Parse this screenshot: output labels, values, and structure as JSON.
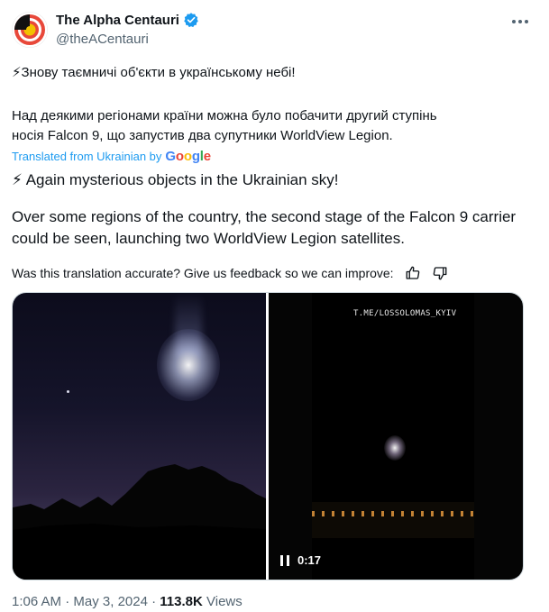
{
  "author": {
    "display_name": "The Alpha Centauri",
    "handle": "@theACentauri"
  },
  "tweet": {
    "original_line_1": "⚡Знову таємничі об'єкти в українському небі!",
    "original_line_2": "Над деякими регіонами країни можна було побачити другий ступінь носія Falcon 9, що запустив два супутники WorldView Legion.",
    "translated_by": "Translated from Ukrainian by",
    "translated_line_1": "⚡ Again mysterious objects in the Ukrainian sky!",
    "translated_line_2": "Over some regions of the country, the second stage of the Falcon 9 carrier could be seen, launching two WorldView Legion satellites.",
    "feedback": "Was this translation accurate? Give us feedback so we can improve:"
  },
  "google_logo": [
    "G",
    "o",
    "o",
    "g",
    "l",
    "e"
  ],
  "media": {
    "video_watermark": "T.ME/LOSSOLOMAS_KYIV",
    "video_time": "0:17"
  },
  "footer": {
    "time": "1:06 AM",
    "separator": "·",
    "date": "May 3, 2024",
    "views_count": "113.8K",
    "views_label": "Views"
  },
  "colors": {
    "link": "#1d9bf0",
    "secondary_text": "#536471",
    "verified": "#1d9bf0"
  }
}
